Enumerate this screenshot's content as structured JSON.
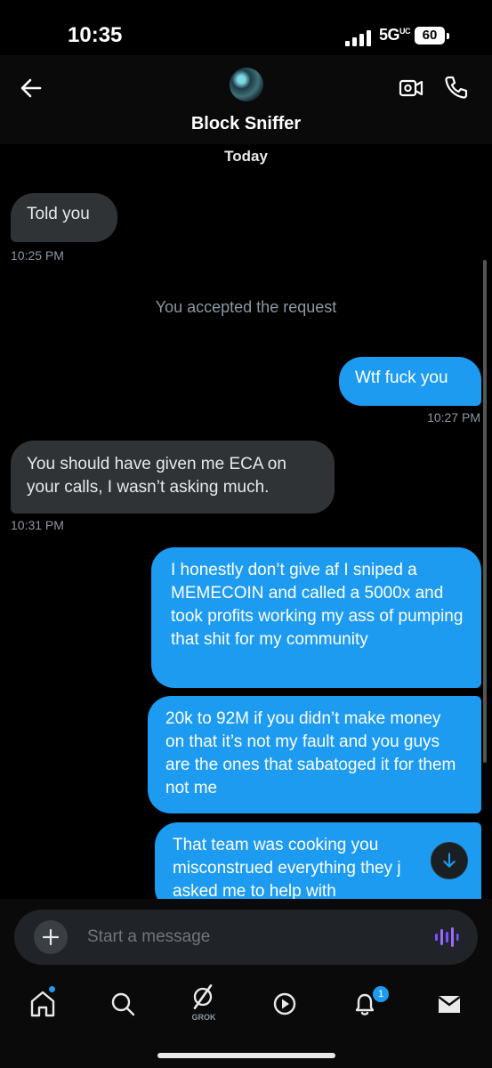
{
  "status": {
    "time": "10:35",
    "network": "5G",
    "network_sup": "UC",
    "battery": "60"
  },
  "header": {
    "contact_name": "Block Sniffer",
    "avatar": "avatar",
    "back_icon": "arrow-left-icon",
    "video_icon": "video-call-icon",
    "call_icon": "phone-icon"
  },
  "conversation": {
    "date_label": "Today",
    "messages": [
      {
        "side": "in",
        "text": "Told you",
        "time": "10:25 PM"
      },
      {
        "side": "system",
        "text": "You accepted the request"
      },
      {
        "side": "out",
        "text": "Wtf fuck you",
        "time": "10:27 PM"
      },
      {
        "side": "in",
        "text": "You should have given me ECA on your calls, I wasn’t asking much.",
        "time": "10:31 PM"
      },
      {
        "side": "out",
        "text": "I honestly don’t give af I sniped a MEMECOIN and called a 5000x and took profits working my ass of pumping that shit for my community"
      },
      {
        "side": "out",
        "text": "20k to 92M if you didn’t make money on that it’s not my fault and you guys are the ones that sabatoged it for them not me"
      },
      {
        "side": "out",
        "text": "That team was cooking you misconstrued everything they j asked me to help with"
      }
    ]
  },
  "composer": {
    "placeholder": "Start a message"
  },
  "nav": {
    "grok_label": "GROK",
    "notification_count": "1"
  },
  "colors": {
    "accent": "#1d9bf0",
    "incoming_bubble": "#2f3336",
    "background": "#000000"
  }
}
